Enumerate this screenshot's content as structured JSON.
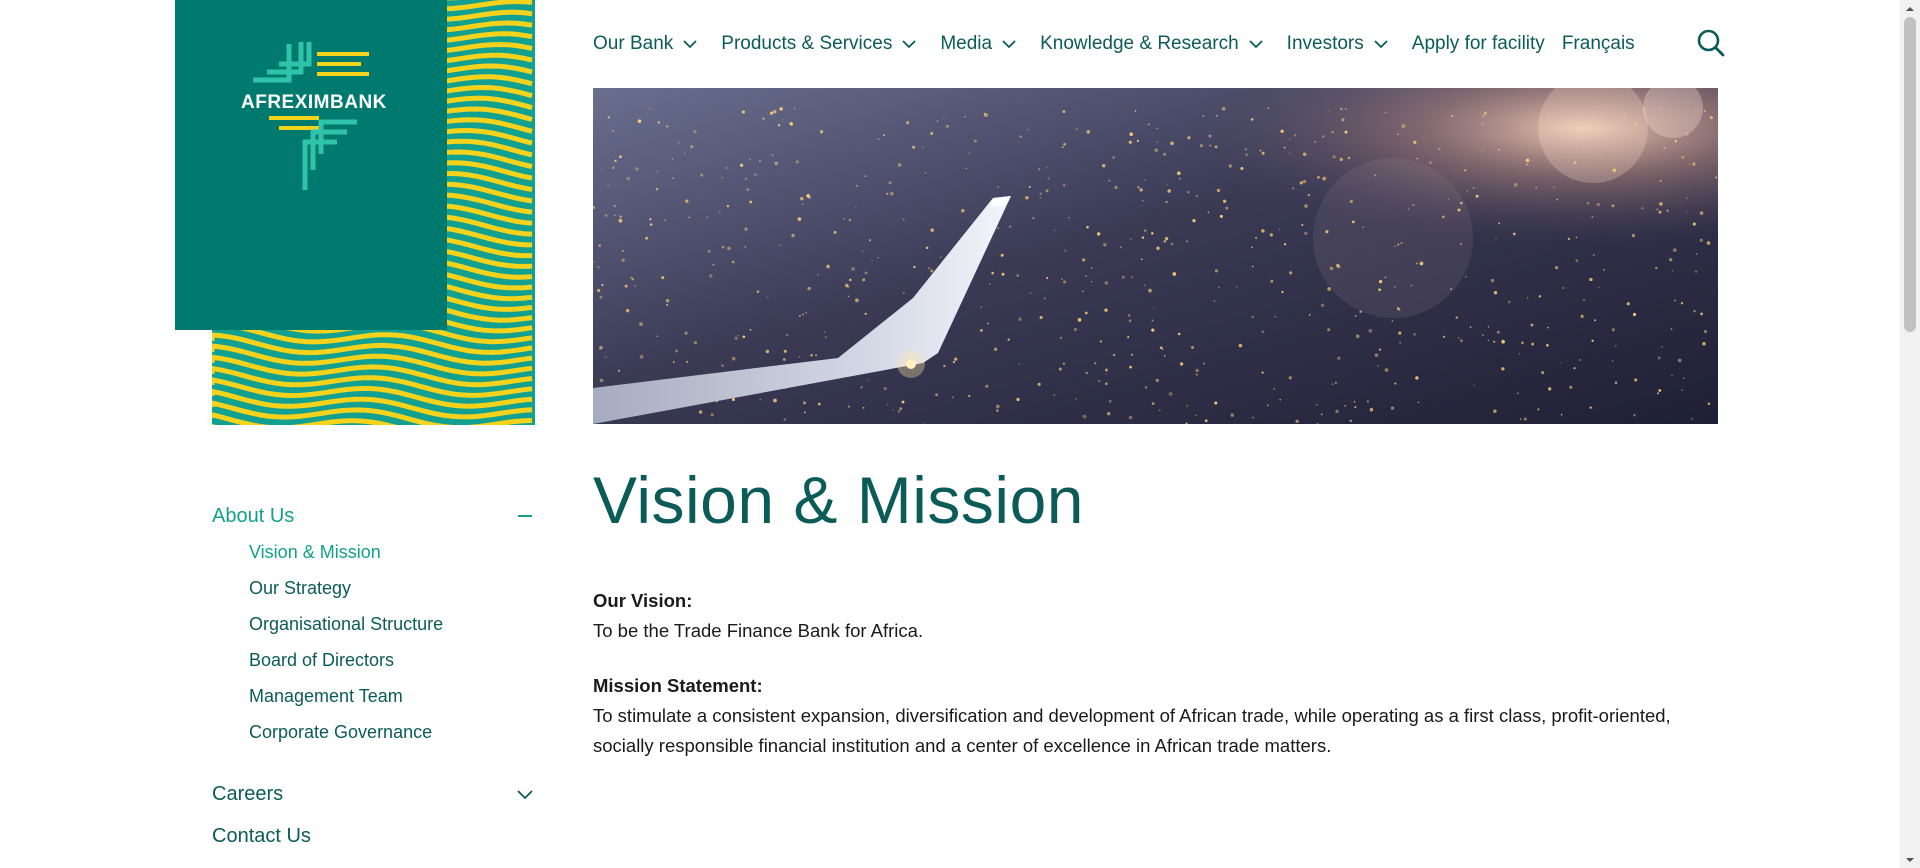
{
  "logo": {
    "text": "AFREXIMBANK"
  },
  "nav": {
    "items": [
      {
        "label": "Our Bank",
        "has_dropdown": true
      },
      {
        "label": "Products & Services",
        "has_dropdown": true
      },
      {
        "label": "Media",
        "has_dropdown": true
      },
      {
        "label": "Knowledge & Research",
        "has_dropdown": true
      },
      {
        "label": "Investors",
        "has_dropdown": true
      },
      {
        "label": "Apply for facility",
        "has_dropdown": false
      },
      {
        "label": "Français",
        "has_dropdown": false
      }
    ],
    "search_icon": "search-icon"
  },
  "page": {
    "title": "Vision & Mission",
    "vision_label": "Our Vision:",
    "vision_text": "To be the Trade Finance Bank for Africa.",
    "mission_label": "Mission Statement:",
    "mission_text": "To stimulate a consistent expansion, diversification and development of African trade, while operating as a first class, profit-oriented, socially responsible financial institution and a center of excellence in African trade matters."
  },
  "sidebar": {
    "about": {
      "label": "About Us",
      "toggle_icon": "minus-icon",
      "items": [
        {
          "label": "Vision & Mission",
          "current": true
        },
        {
          "label": "Our Strategy"
        },
        {
          "label": "Organisational Structure"
        },
        {
          "label": "Board of Directors"
        },
        {
          "label": "Management Team"
        },
        {
          "label": "Corporate Governance"
        }
      ]
    },
    "careers": {
      "label": "Careers",
      "toggle_icon": "chevron-down-icon"
    },
    "contact": {
      "label": "Contact Us"
    }
  },
  "colors": {
    "primary_teal": "#007a6e",
    "dark_teal_text": "#0b5c58",
    "accent_green": "#12a08a",
    "pattern_yellow": "#f5d21c"
  }
}
